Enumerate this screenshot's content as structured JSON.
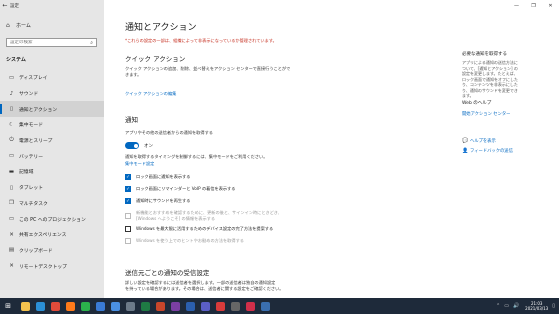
{
  "window": {
    "app_title": "設定",
    "controls": [
      "—",
      "❐",
      "✕"
    ]
  },
  "sidebar": {
    "home_label": "ホーム",
    "search_placeholder": "設定の検索",
    "section_label": "システム",
    "items": [
      {
        "label": "ディスプレイ",
        "icon": "display-icon",
        "glyph": "▭"
      },
      {
        "label": "サウンド",
        "icon": "sound-icon",
        "glyph": "♪"
      },
      {
        "label": "通知とアクション",
        "icon": "notification-icon",
        "glyph": "▯"
      },
      {
        "label": "集中モード",
        "icon": "focus-assist-icon",
        "glyph": "☾"
      },
      {
        "label": "電源とスリープ",
        "icon": "power-icon",
        "glyph": "⏻"
      },
      {
        "label": "バッテリー",
        "icon": "battery-icon",
        "glyph": "▭"
      },
      {
        "label": "記憶域",
        "icon": "storage-icon",
        "glyph": "▬"
      },
      {
        "label": "タブレット",
        "icon": "tablet-icon",
        "glyph": "▯"
      },
      {
        "label": "マルチタスク",
        "icon": "multitasking-icon",
        "glyph": "❐"
      },
      {
        "label": "この PC へのプロジェクション",
        "icon": "projection-icon",
        "glyph": "▭"
      },
      {
        "label": "共有エクスペリエンス",
        "icon": "shared-experiences-icon",
        "glyph": "✕"
      },
      {
        "label": "クリップボード",
        "icon": "clipboard-icon",
        "glyph": "▤"
      },
      {
        "label": "リモートデスクトップ",
        "icon": "remote-desktop-icon",
        "glyph": "✕"
      }
    ],
    "active_index": 2
  },
  "main": {
    "title": "通知とアクション",
    "warning": "*これらの設定の一部は、組織によって非表示になっているか管理されています。",
    "quick_actions": {
      "heading": "クイック アクション",
      "desc_line1": "クイック アクションの追加、削除、並べ替えをアクション センターで直接行うことがで",
      "desc_line2": "きます。",
      "edit_link": "クイック アクションの編集"
    },
    "notifications": {
      "heading": "通知",
      "toggle_label": "アプリやその他の送信者からの通知を取得する",
      "toggle_state": "オン",
      "focus_desc": "通知を取得するタイミングを制御するには、集中モードをご利用ください。",
      "focus_link": "集中モード設定",
      "checkboxes": [
        {
          "label": "ロック画面に通知を表示する",
          "checked": true,
          "disabled": false
        },
        {
          "label": "ロック画面にリマインダーと VoIP の着信を表示する",
          "checked": true,
          "disabled": false
        },
        {
          "label": "通知時にサウンドを再生する",
          "checked": true,
          "disabled": false
        },
        {
          "label": "新機能とおすすめを確認するために、更新の後と、サインイン時にときどき、\n[Windows へようこそ] の情報を表示する",
          "checked": false,
          "disabled": true
        },
        {
          "label": "Windows を最大限に活用するためのデバイス設定の完了方法を提案する",
          "checked": false,
          "disabled": false
        },
        {
          "label": "Windows を使う上でのヒントやお勧めの方法を取得する",
          "checked": false,
          "disabled": true
        }
      ]
    },
    "senders": {
      "heading": "送信元ごとの通知の受信設定",
      "desc_line1": "詳しい設定を確認するには送信者を選択します。一部の送信者は独自の通知設定",
      "desc_line2": "を持っている場合があります。その場合は、送信者に関する設定をご確認ください。"
    }
  },
  "right": {
    "related_title": "必要な通知を取得する",
    "related_desc": [
      "アプリによる通知の送信方法に",
      "ついて、[通知とアクション] の",
      "設定を変更します。たとえば、",
      "ロック画面で通知をオフにした",
      "り、コンテンツを非表示にした",
      "り、通知のサウンドを変更でき",
      "ます。"
    ],
    "web_help_title": "Web のヘルプ",
    "web_help_link": "開始アクション センター",
    "help_link": "ヘルプを表示",
    "feedback_link": "フィードバックの送信"
  },
  "taskbar": {
    "apps": [
      {
        "name": "taskbar-app-explorer",
        "color": "#f2c14e"
      },
      {
        "name": "taskbar-app-edge",
        "color": "#2b8fd6"
      },
      {
        "name": "taskbar-app-chrome",
        "color": "#e04b3a"
      },
      {
        "name": "taskbar-app-firefox",
        "color": "#ff7a1a"
      },
      {
        "name": "taskbar-app-line",
        "color": "#2bb24c"
      },
      {
        "name": "taskbar-app-mail",
        "color": "#3a7bd5"
      },
      {
        "name": "taskbar-app-photos",
        "color": "#4a90e2"
      },
      {
        "name": "taskbar-app-store",
        "color": "#6c7a89"
      },
      {
        "name": "taskbar-app-excel",
        "color": "#1f7a44"
      },
      {
        "name": "taskbar-app-powerpoint",
        "color": "#c8462b"
      },
      {
        "name": "taskbar-app-onenote",
        "color": "#7b3fa3"
      },
      {
        "name": "taskbar-app-word",
        "color": "#2b5fae"
      },
      {
        "name": "taskbar-app-teams",
        "color": "#5b5fc7"
      },
      {
        "name": "taskbar-app-maps",
        "color": "#d83b3b"
      },
      {
        "name": "taskbar-app-camera",
        "color": "#666666"
      },
      {
        "name": "taskbar-app-media",
        "color": "#d12f4a"
      },
      {
        "name": "taskbar-app-settings",
        "color": "#3a6fb0"
      }
    ],
    "time": "21:03",
    "date": "2021/03/13"
  }
}
